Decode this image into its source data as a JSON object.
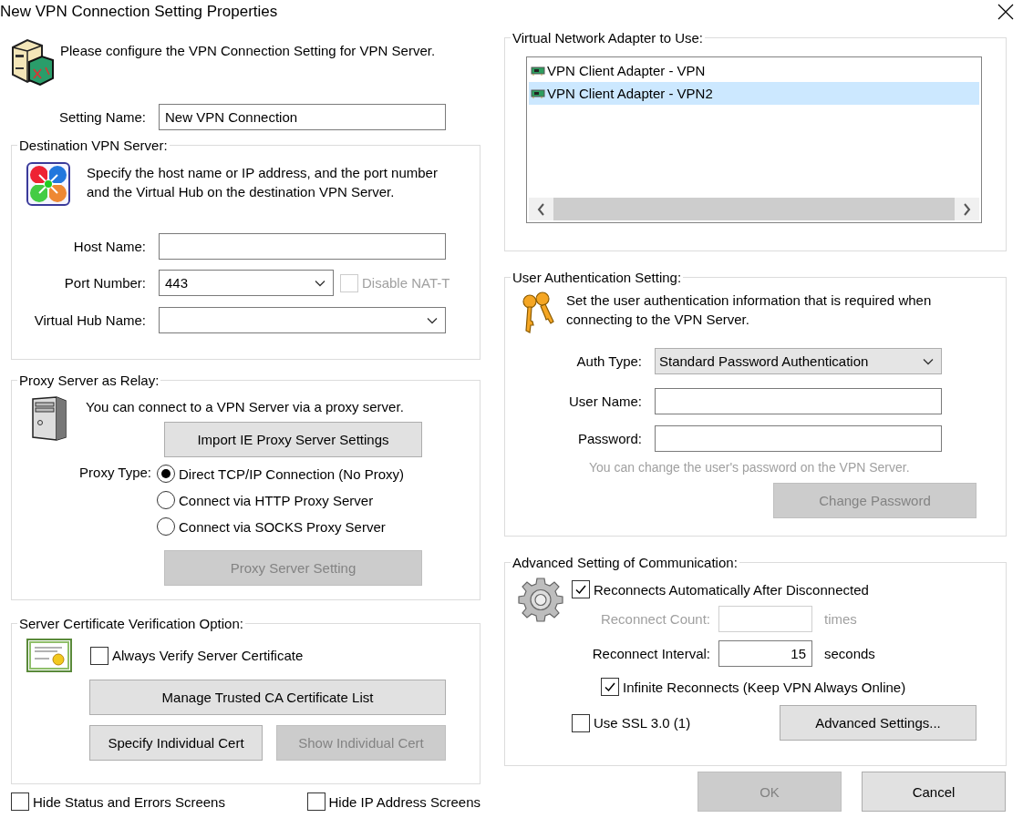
{
  "window": {
    "title": "New VPN Connection Setting Properties"
  },
  "intro": "Please configure the VPN Connection Setting for VPN Server.",
  "setting_name": {
    "label": "Setting Name:",
    "value": "New VPN Connection"
  },
  "destination": {
    "title": "Destination VPN Server:",
    "description": "Specify the host name or IP address, and the port number\nand the Virtual Hub on the destination VPN Server.",
    "host_name": {
      "label": "Host Name:"
    },
    "port_number": {
      "label": "Port Number:",
      "value": "443"
    },
    "disable_nat_t": {
      "label": "Disable NAT-T",
      "checked": false,
      "disabled": true
    },
    "virtual_hub_name": {
      "label": "Virtual Hub Name:"
    }
  },
  "proxy": {
    "title": "Proxy Server as Relay:",
    "description": "You can connect to a VPN Server via a proxy server.",
    "import_button": {
      "label": "Import IE Proxy Server Settings",
      "disabled": false
    },
    "type_label": "Proxy Type:",
    "options": [
      {
        "label": "Direct TCP/IP Connection (No Proxy)",
        "selected": true
      },
      {
        "label": "Connect via HTTP Proxy Server",
        "selected": false
      },
      {
        "label": "Connect via SOCKS Proxy Server",
        "selected": false
      }
    ],
    "setting_button": {
      "label": "Proxy Server Setting",
      "disabled": true
    }
  },
  "certificate": {
    "title": "Server Certificate Verification Option:",
    "always_verify": {
      "label": "Always Verify Server Certificate",
      "checked": false
    },
    "manage_button": {
      "label": "Manage Trusted CA Certificate List",
      "disabled": false
    },
    "specify_button": {
      "label": "Specify Individual Cert",
      "disabled": false
    },
    "show_button": {
      "label": "Show Individual Cert",
      "disabled": true
    }
  },
  "bottom_options": [
    {
      "label": "Hide Status and Errors Screens",
      "checked": false
    },
    {
      "label": "Hide IP Address Screens",
      "checked": false
    }
  ],
  "adapters": {
    "title": "Virtual Network Adapter to Use:",
    "items": [
      {
        "label": "VPN Client Adapter - VPN",
        "selected": false
      },
      {
        "label": "VPN Client Adapter - VPN2",
        "selected": true
      }
    ]
  },
  "auth": {
    "title": "User Authentication Setting:",
    "description": "Set the user authentication information that is required when\nconnecting to the VPN Server.",
    "auth_type": {
      "label": "Auth Type:",
      "value": "Standard Password Authentication"
    },
    "user_name": {
      "label": "User Name:"
    },
    "password": {
      "label": "Password:"
    },
    "hint": {
      "text": "You can change the user's password on the VPN Server.",
      "disabled": true
    },
    "change_password": {
      "label": "Change Password",
      "disabled": true
    }
  },
  "advanced": {
    "title": "Advanced Setting of Communication:",
    "auto_reconnect": {
      "label": "Reconnects Automatically After Disconnected",
      "checked": true
    },
    "reconnect_count": {
      "label": "Reconnect Count:",
      "unit": "times",
      "disabled": true
    },
    "reconnect_interval": {
      "label": "Reconnect Interval:",
      "value": "15",
      "unit": "seconds",
      "disabled": false
    },
    "infinite": {
      "label": "Infinite Reconnects (Keep VPN Always Online)",
      "checked": true
    },
    "ssl": {
      "label": "Use SSL 3.0 (1)",
      "checked": false
    },
    "advanced_button": {
      "label": "Advanced Settings...",
      "disabled": false
    }
  },
  "buttons": [
    {
      "label": "OK",
      "disabled": true
    },
    {
      "label": "Cancel",
      "disabled": false
    }
  ]
}
